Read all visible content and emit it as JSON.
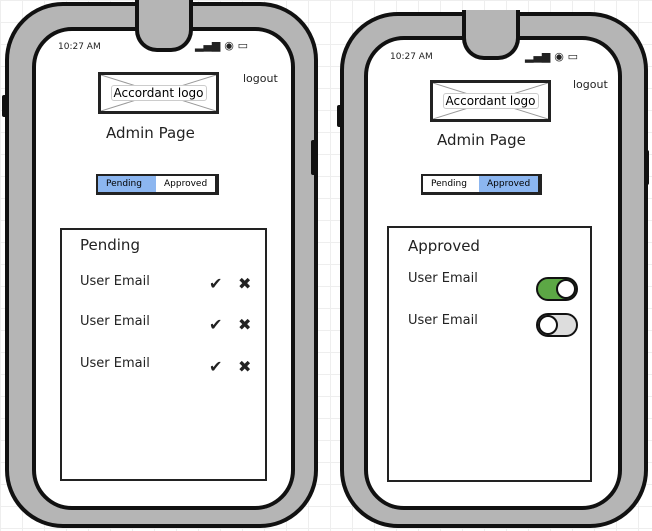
{
  "status_time": "10:27 AM",
  "phones": [
    {
      "logo": "Accordant logo",
      "logout": "logout",
      "title": "Admin Page",
      "tabs": [
        {
          "label": "Pending",
          "active": true
        },
        {
          "label": "Approved",
          "active": false
        }
      ],
      "panel_title": "Pending",
      "rows": [
        {
          "email": "User Email"
        },
        {
          "email": "User Email"
        },
        {
          "email": "User Email"
        }
      ],
      "icons": {
        "approve": "check-icon",
        "reject": "x-icon"
      }
    },
    {
      "logo": "Accordant logo",
      "logout": "logout",
      "title": "Admin Page",
      "tabs": [
        {
          "label": "Pending",
          "active": false
        },
        {
          "label": "Approved",
          "active": true
        }
      ],
      "panel_title": "Approved",
      "rows": [
        {
          "email": "User Email",
          "enabled": true
        },
        {
          "email": "User Email",
          "enabled": false
        }
      ]
    }
  ],
  "colors": {
    "active_tab": "#8cb6f0",
    "toggle_on": "#5ca745",
    "toggle_off": "#dddddd",
    "phone_body": "#b5b5b5"
  }
}
